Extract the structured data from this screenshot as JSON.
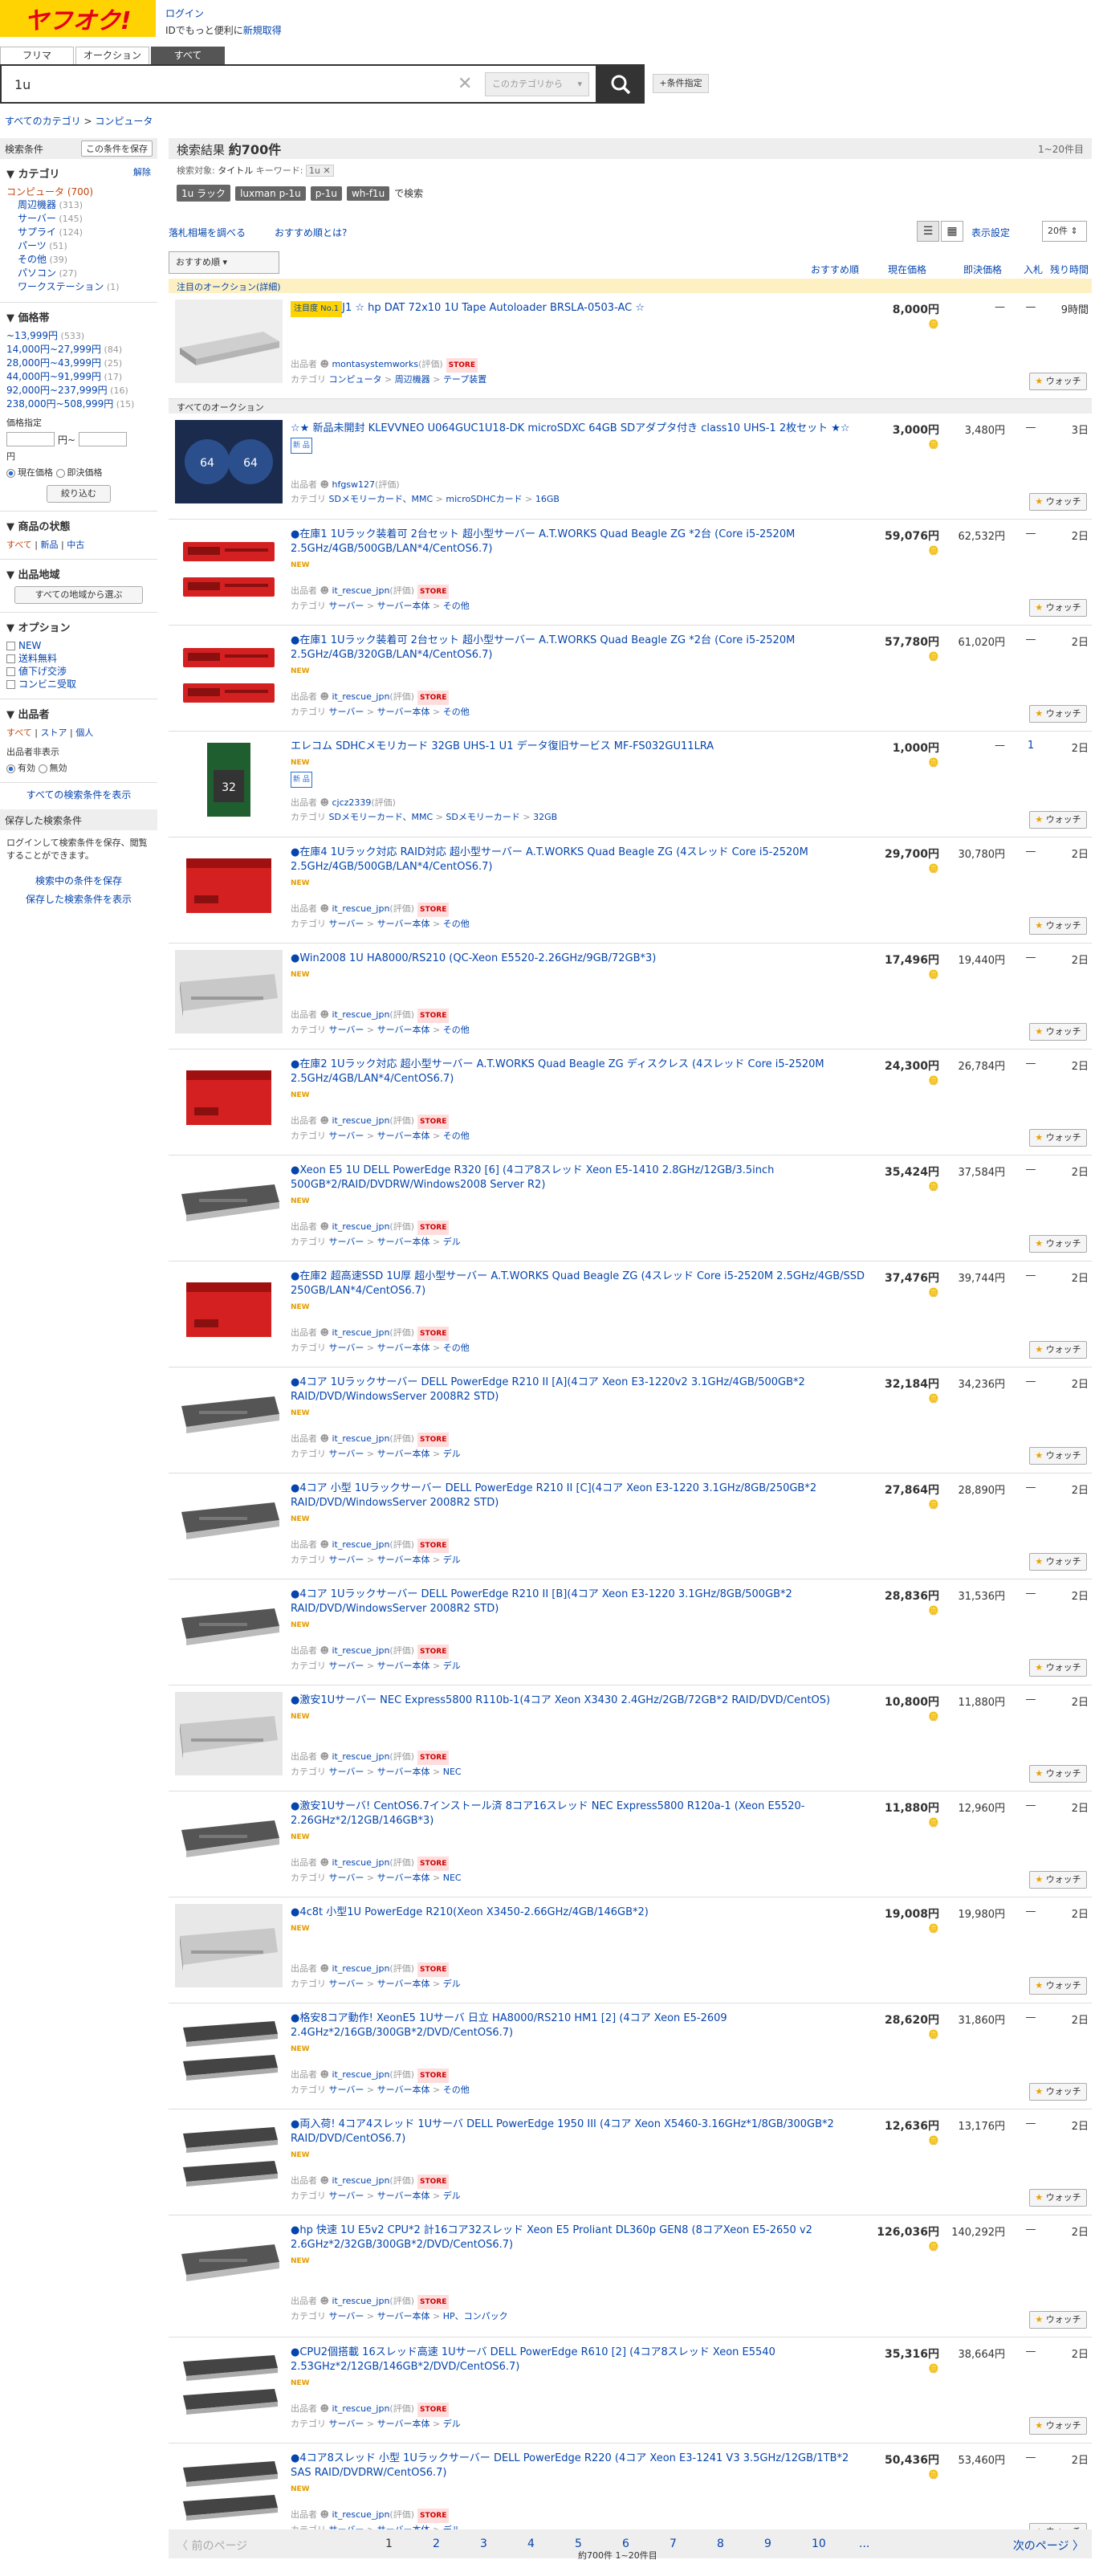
{
  "header": {
    "logo": "ヤフオク!",
    "login": "ログイン",
    "login_note_a": "IDでもっと便利に",
    "login_note_b": "新規取得"
  },
  "tabs": [
    "フリマ",
    "オークション",
    "すべて"
  ],
  "search": {
    "query": "1u",
    "category_placeholder": "このカテゴリから",
    "cond_button": "+条件指定"
  },
  "breadcrumb": {
    "a": "すべてのカテゴリ",
    "sep": ">",
    "b": "コンピュータ"
  },
  "sidebar": {
    "cond_label": "検索条件",
    "save_button": "この条件を保存",
    "category_title": "カテゴリ",
    "category_clear": "解除",
    "category_root": "コンピュータ",
    "category_root_count": "(700)",
    "categories": [
      [
        "周辺機器",
        "(313)"
      ],
      [
        "サーバー",
        "(145)"
      ],
      [
        "サプライ",
        "(124)"
      ],
      [
        "パーツ",
        "(51)"
      ],
      [
        "その他",
        "(39)"
      ],
      [
        "パソコン",
        "(27)"
      ],
      [
        "ワークステーション",
        "(1)"
      ]
    ],
    "price_title": "価格帯",
    "prices": [
      [
        "~13,999円",
        "(533)"
      ],
      [
        "14,000円~27,999円",
        "(84)"
      ],
      [
        "28,000円~43,999円",
        "(25)"
      ],
      [
        "44,000円~91,999円",
        "(17)"
      ],
      [
        "92,000円~237,999円",
        "(16)"
      ],
      [
        "238,000円~508,999円",
        "(15)"
      ]
    ],
    "price_spec": "価格指定",
    "yen_from": "円~",
    "yen_to": "円",
    "radio_now": "現在価格",
    "radio_buy": "即決価格",
    "narrow": "絞り込む",
    "state_title": "商品の状態",
    "state_all": "すべて",
    "state_new": "新品",
    "state_used": "中古",
    "region_title": "出品地域",
    "region_btn": "すべての地域から選ぶ",
    "option_title": "オプション",
    "options": [
      "NEW",
      "送料無料",
      "値下げ交渉",
      "コンビニ受取"
    ],
    "seller_title": "出品者",
    "seller_all": "すべて",
    "seller_store": "ストア",
    "seller_person": "個人",
    "seller_show": "出品者非表示",
    "seller_on": "有効",
    "seller_off": "無効",
    "all_cond": "すべての検索条件を表示",
    "saved_title": "保存した検索条件",
    "saved_note": "ログインして検索条件を保存、閲覧することができます。",
    "save_current": "検索中の条件を保存",
    "show_saved": "保存した検索条件を表示"
  },
  "results": {
    "title": "検索結果",
    "count": "約700件",
    "range": "1~20件目",
    "q_label": "検索対象",
    "q_val": "タイトル",
    "kw_label": "キーワード",
    "kw_val": "1u",
    "suggests": [
      "1u ラック",
      "luxman p-1u",
      "p-1u",
      "wh-f1u"
    ],
    "suggest_tail": "で検索",
    "link1": "落札相場を調べる",
    "link2": "おすすめ順とは?",
    "display": "表示設定",
    "perpage": "20件",
    "sort": "おすすめ順",
    "col_rec": "おすすめ順",
    "col_now": "現在価格",
    "col_buy": "即決価格",
    "col_bid": "入札",
    "col_rem": "残り時間",
    "attention": "注目のオークション(詳細)",
    "all_auctions": "すべてのオークション"
  },
  "items": [
    {
      "title": "J1 ☆ hp DAT 72x10 1U Tape Autoloader BRSLA-0503-AC ☆",
      "hot": "注目度 No.1",
      "price": "8,000円",
      "buy": "—",
      "bid": "—",
      "rem": "9時間",
      "seller": "montasystemworks",
      "cat1": "コンピュータ",
      "cat2": "周辺機器",
      "cat3": "テープ装置",
      "store": true,
      "thumb": "tape"
    },
    {
      "title": "☆★ 新品未開封 KLEVVNEO U064GUC1U18-DK microSDXC 64GB SDアダプタ付き class10 UHS-1 2枚セット ★☆",
      "price": "3,000円",
      "buy": "3,480円",
      "bid": "—",
      "rem": "3日",
      "seller": "hfgsw127",
      "cat1": "SDメモリーカード、MMC",
      "cat2": "microSDHCカード",
      "cat3": "16GB",
      "store": false,
      "thumb": "sd"
    },
    {
      "title": "●在庫1 1Uラック装着可 2台セット 超小型サーバー A.T.WORKS Quad Beagle ZG *2台 (Core i5-2520M 2.5GHz/4GB/500GB/LAN*4/CentOS6.7)",
      "price": "59,076円",
      "buy": "62,532円",
      "bid": "—",
      "rem": "2日",
      "seller": "it_rescue_jpn",
      "cat1": "サーバー",
      "cat2": "サーバー本体",
      "cat3": "その他",
      "store": true,
      "thumb": "red2"
    },
    {
      "title": "●在庫1 1Uラック装着可 2台セット 超小型サーバー A.T.WORKS Quad Beagle ZG *2台 (Core i5-2520M 2.5GHz/4GB/320GB/LAN*4/CentOS6.7)",
      "price": "57,780円",
      "buy": "61,020円",
      "bid": "—",
      "rem": "2日",
      "seller": "it_rescue_jpn",
      "cat1": "サーバー",
      "cat2": "サーバー本体",
      "cat3": "その他",
      "store": true,
      "thumb": "red2"
    },
    {
      "title": "エレコム SDHCメモリカード 32GB UHS-1 U1 データ復旧サービス MF-FS032GU11LRA",
      "price": "1,000円",
      "buy": "—",
      "bid": "1",
      "rem": "2日",
      "seller": "cjcz2339",
      "cat1": "SDメモリーカード、MMC",
      "cat2": "SDメモリーカード",
      "cat3": "32GB",
      "store": false,
      "thumb": "sdcard"
    },
    {
      "title": "●在庫4 1Uラック対応 RAID対応 超小型サーバー A.T.WORKS Quad Beagle ZG (4スレッド Core i5-2520M 2.5GHz/4GB/500GB/LAN*4/CentOS6.7)",
      "price": "29,700円",
      "buy": "30,780円",
      "bid": "—",
      "rem": "2日",
      "seller": "it_rescue_jpn",
      "cat1": "サーバー",
      "cat2": "サーバー本体",
      "cat3": "その他",
      "store": true,
      "thumb": "red1"
    },
    {
      "title": "●Win2008 1U HA8000/RS210 (QC-Xeon E5520-2.26GHz/9GB/72GB*3)",
      "price": "17,496円",
      "buy": "19,440円",
      "bid": "—",
      "rem": "2日",
      "seller": "it_rescue_jpn",
      "cat1": "サーバー",
      "cat2": "サーバー本体",
      "cat3": "その他",
      "store": true,
      "thumb": "silver"
    },
    {
      "title": "●在庫2 1Uラック対応 超小型サーバー A.T.WORKS Quad Beagle ZG ディスクレス (4スレッド Core i5-2520M 2.5GHz/4GB/LAN*4/CentOS6.7)",
      "price": "24,300円",
      "buy": "26,784円",
      "bid": "—",
      "rem": "2日",
      "seller": "it_rescue_jpn",
      "cat1": "サーバー",
      "cat2": "サーバー本体",
      "cat3": "その他",
      "store": true,
      "thumb": "red1"
    },
    {
      "title": "●Xeon E5 1U DELL PowerEdge R320 [6] (4コア8スレッド Xeon E5-1410 2.8GHz/12GB/3.5inch 500GB*2/RAID/DVDRW/Windows2008 Server R2)",
      "price": "35,424円",
      "buy": "37,584円",
      "bid": "—",
      "rem": "2日",
      "seller": "it_rescue_jpn",
      "cat1": "サーバー",
      "cat2": "サーバー本体",
      "cat3": "デル",
      "store": true,
      "thumb": "dark"
    },
    {
      "title": "●在庫2 超高速SSD 1U厚 超小型サーバー A.T.WORKS Quad Beagle ZG (4スレッド Core i5-2520M 2.5GHz/4GB/SSD 250GB/LAN*4/CentOS6.7)",
      "price": "37,476円",
      "buy": "39,744円",
      "bid": "—",
      "rem": "2日",
      "seller": "it_rescue_jpn",
      "cat1": "サーバー",
      "cat2": "サーバー本体",
      "cat3": "その他",
      "store": true,
      "thumb": "red1"
    },
    {
      "title": "●4コア 1Uラックサーバー DELL PowerEdge R210 II [A](4コア Xeon E3-1220v2 3.1GHz/4GB/500GB*2 RAID/DVD/WindowsServer 2008R2 STD)",
      "price": "32,184円",
      "buy": "34,236円",
      "bid": "—",
      "rem": "2日",
      "seller": "it_rescue_jpn",
      "cat1": "サーバー",
      "cat2": "サーバー本体",
      "cat3": "デル",
      "store": true,
      "thumb": "dark"
    },
    {
      "title": "●4コア 小型 1Uラックサーバー DELL PowerEdge R210 II [C](4コア Xeon E3-1220 3.1GHz/8GB/250GB*2 RAID/DVD/WindowsServer 2008R2 STD)",
      "price": "27,864円",
      "buy": "28,890円",
      "bid": "—",
      "rem": "2日",
      "seller": "it_rescue_jpn",
      "cat1": "サーバー",
      "cat2": "サーバー本体",
      "cat3": "デル",
      "store": true,
      "thumb": "dark"
    },
    {
      "title": "●4コア 1Uラックサーバー DELL PowerEdge R210 II [B](4コア Xeon E3-1220 3.1GHz/8GB/500GB*2 RAID/DVD/WindowsServer 2008R2 STD)",
      "price": "28,836円",
      "buy": "31,536円",
      "bid": "—",
      "rem": "2日",
      "seller": "it_rescue_jpn",
      "cat1": "サーバー",
      "cat2": "サーバー本体",
      "cat3": "デル",
      "store": true,
      "thumb": "dark"
    },
    {
      "title": "●激安1Uサーバー NEC Express5800 R110b-1(4コア Xeon X3430 2.4GHz/2GB/72GB*2 RAID/DVD/CentOS)",
      "price": "10,800円",
      "buy": "11,880円",
      "bid": "—",
      "rem": "2日",
      "seller": "it_rescue_jpn",
      "cat1": "サーバー",
      "cat2": "サーバー本体",
      "cat3": "NEC",
      "store": true,
      "thumb": "silver"
    },
    {
      "title": "●激安1Uサーバ! CentOS6.7インストール済 8コア16スレッド NEC Express5800 R120a-1 (Xeon E5520-2.26GHz*2/12GB/146GB*3)",
      "price": "11,880円",
      "buy": "12,960円",
      "bid": "—",
      "rem": "2日",
      "seller": "it_rescue_jpn",
      "cat1": "サーバー",
      "cat2": "サーバー本体",
      "cat3": "NEC",
      "store": true,
      "thumb": "dark"
    },
    {
      "title": "●4c8t 小型1U PowerEdge R210(Xeon X3450-2.66GHz/4GB/146GB*2)",
      "price": "19,008円",
      "buy": "19,980円",
      "bid": "—",
      "rem": "2日",
      "seller": "it_rescue_jpn",
      "cat1": "サーバー",
      "cat2": "サーバー本体",
      "cat3": "デル",
      "store": true,
      "thumb": "silver"
    },
    {
      "title": "●格安8コア動作! XeonE5 1Uサーバ 日立 HA8000/RS210 HM1 [2] (4コア Xeon E5-2609 2.4GHz*2/16GB/300GB*2/DVD/CentOS6.7)",
      "price": "28,620円",
      "buy": "31,860円",
      "bid": "—",
      "rem": "2日",
      "seller": "it_rescue_jpn",
      "cat1": "サーバー",
      "cat2": "サーバー本体",
      "cat3": "その他",
      "store": true,
      "thumb": "dark2"
    },
    {
      "title": "●両入荷! 4コア4スレッド 1Uサーバ DELL PowerEdge 1950 III (4コア Xeon X5460-3.16GHz*1/8GB/300GB*2 RAID/DVD/CentOS6.7)",
      "price": "12,636円",
      "buy": "13,176円",
      "bid": "—",
      "rem": "2日",
      "seller": "it_rescue_jpn",
      "cat1": "サーバー",
      "cat2": "サーバー本体",
      "cat3": "デル",
      "store": true,
      "thumb": "dark2"
    },
    {
      "title": "●hp 快速 1U E5v2 CPU*2 計16コア32スレッド Xeon E5 Proliant DL360p GEN8 (8コアXeon E5-2650 v2 2.6GHz*2/32GB/300GB*2/DVD/CentOS6.7)",
      "price": "126,036円",
      "buy": "140,292円",
      "bid": "—",
      "rem": "2日",
      "seller": "it_rescue_jpn",
      "cat1": "サーバー",
      "cat2": "サーバー本体",
      "cat3": "HP、コンパック",
      "store": true,
      "thumb": "dark",
      "tall": true
    },
    {
      "title": "●CPU2個搭載 16スレッド高速 1Uサーバ DELL PowerEdge R610 [2] (4コア8スレッド Xeon E5540 2.53GHz*2/12GB/146GB*2/DVD/CentOS6.7)",
      "price": "35,316円",
      "buy": "38,664円",
      "bid": "—",
      "rem": "2日",
      "seller": "it_rescue_jpn",
      "cat1": "サーバー",
      "cat2": "サーバー本体",
      "cat3": "デル",
      "store": true,
      "thumb": "dark2"
    },
    {
      "title": "●4コア8スレッド 小型 1Uラックサーバー DELL PowerEdge R220 (4コア Xeon E3-1241 V3 3.5GHz/12GB/1TB*2 SAS RAID/DVDRW/CentOS6.7)",
      "price": "50,436円",
      "buy": "53,460円",
      "bid": "—",
      "rem": "2日",
      "seller": "it_rescue_jpn",
      "cat1": "サーバー",
      "cat2": "サーバー本体",
      "cat3": "デル",
      "store": true,
      "thumb": "dark2"
    }
  ],
  "labels": {
    "seller": "出品者",
    "category": "カテゴリ",
    "rating": "(評価)",
    "store": "STORE",
    "watch": "ウォッチ",
    "new": "NEW",
    "newsq": "新 品",
    "sep": ">"
  },
  "pager": {
    "prev": "前のページ",
    "next": "次のページ",
    "pages": [
      "1",
      "2",
      "3",
      "4",
      "5",
      "6",
      "7",
      "8",
      "9",
      "10",
      "..."
    ],
    "summary": "約700件  1~20件目"
  }
}
